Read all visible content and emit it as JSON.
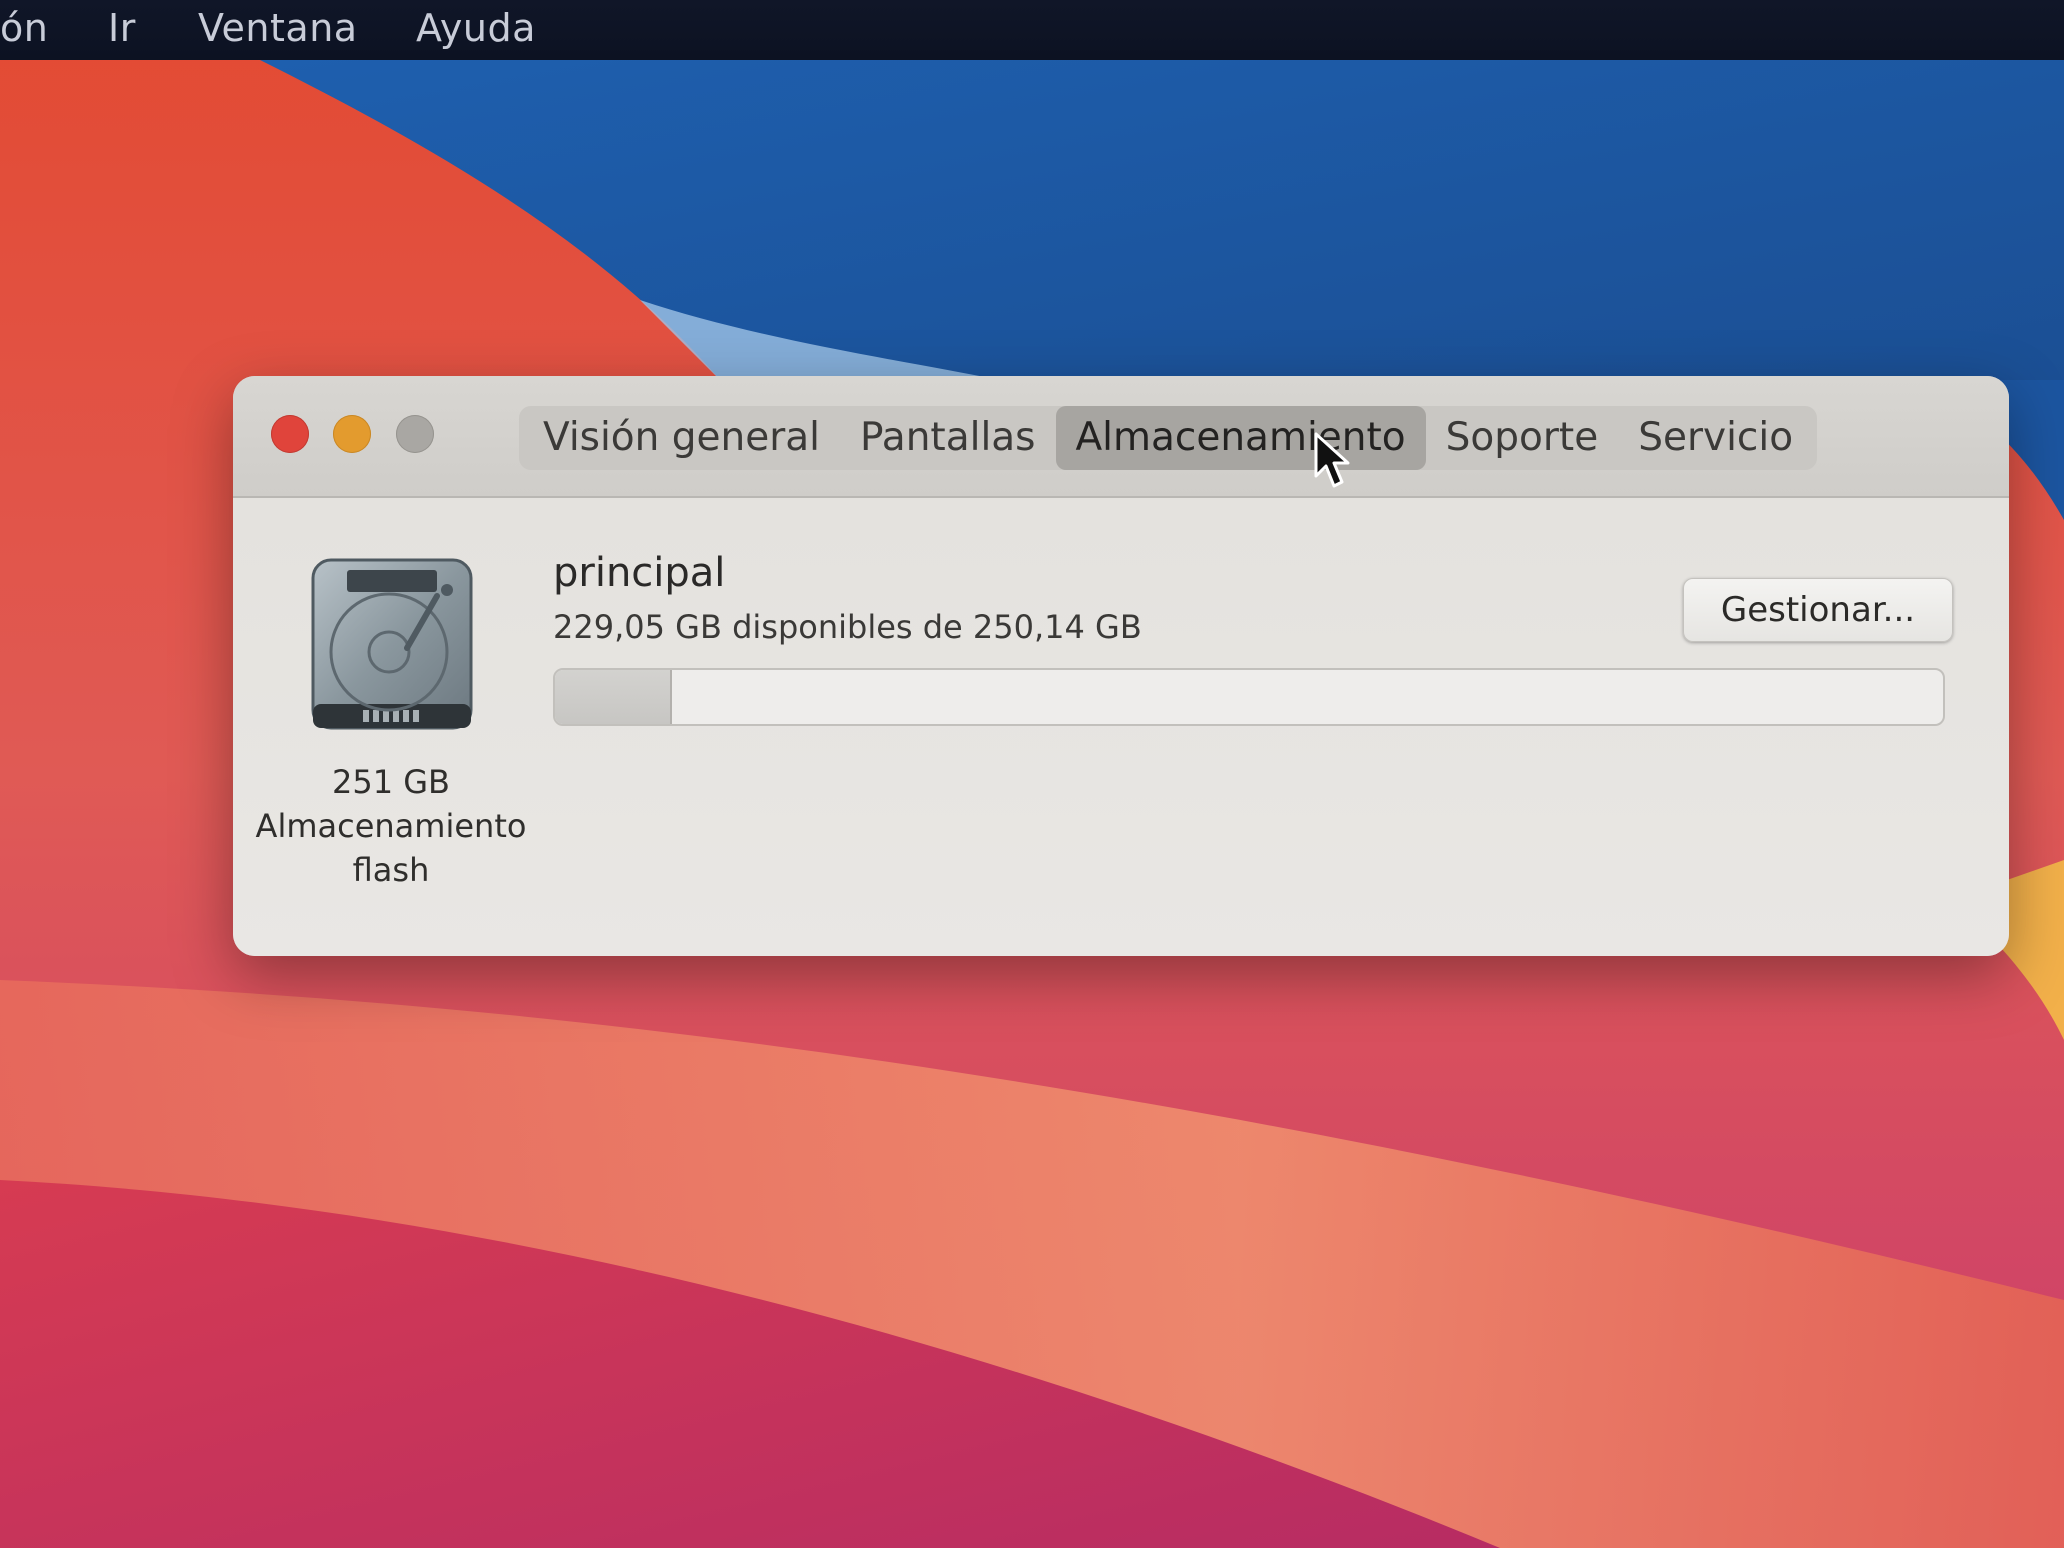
{
  "menubar": {
    "items": [
      "ón",
      "Ir",
      "Ventana",
      "Ayuda"
    ]
  },
  "window": {
    "tabs": [
      {
        "label": "Visión general",
        "active": false
      },
      {
        "label": "Pantallas",
        "active": false
      },
      {
        "label": "Almacenamiento",
        "active": true
      },
      {
        "label": "Soporte",
        "active": false
      },
      {
        "label": "Servicio",
        "active": false
      }
    ],
    "disk": {
      "icon": "hard-drive-icon",
      "capacity": "251 GB",
      "type_line1": "Almacenamiento",
      "type_line2": "flash"
    },
    "volume": {
      "name": "principal",
      "availability": "229,05 GB disponibles de 250,14 GB",
      "used_fraction": 0.084
    },
    "manage_button": "Gestionar..."
  },
  "colors": {
    "close": "#e0443b",
    "minimize": "#e39b2e",
    "zoom": "#a9a7a3"
  }
}
